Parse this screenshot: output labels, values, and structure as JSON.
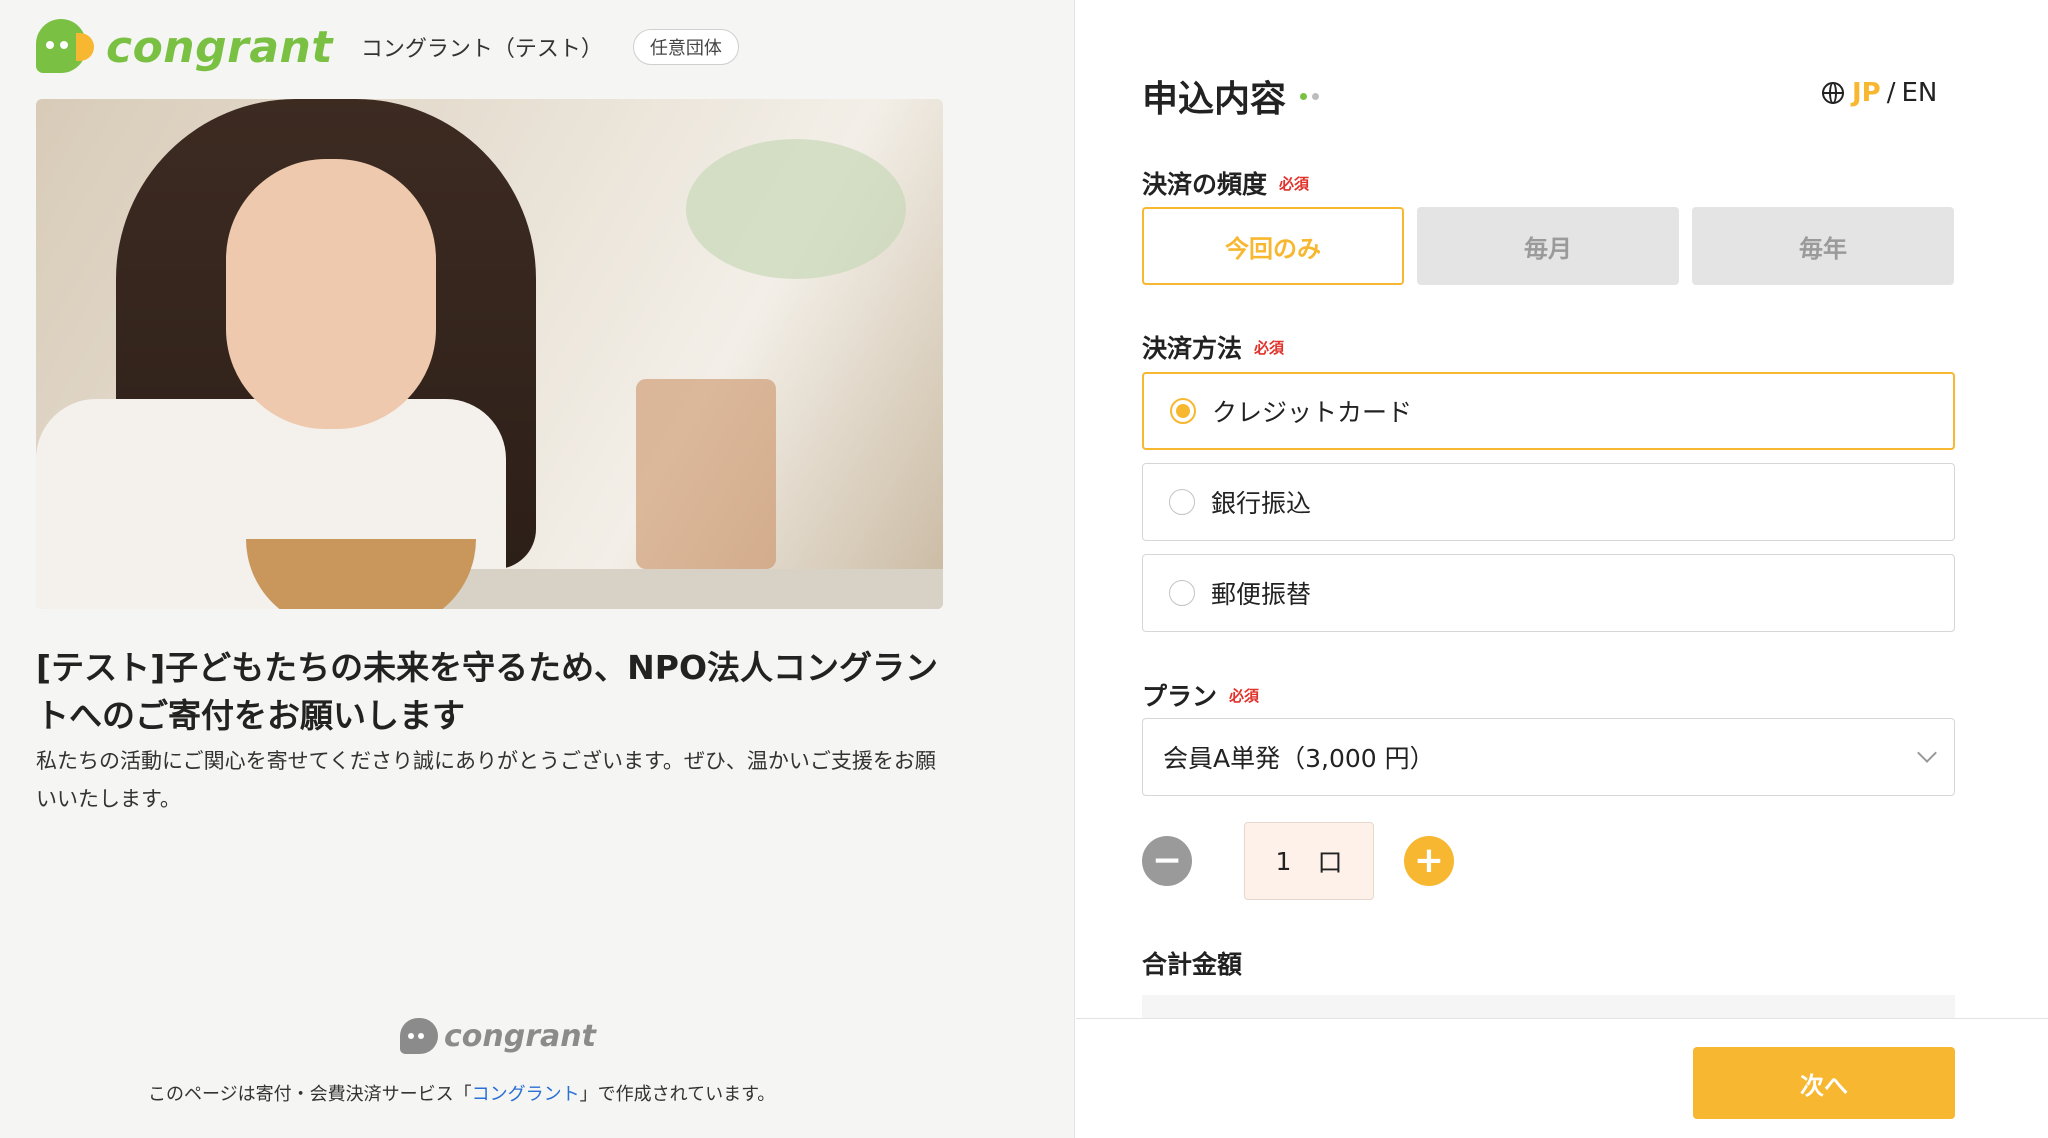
{
  "brand": {
    "logo_text": "congrant",
    "org_name": "コングラント（テスト）",
    "org_badge": "任意団体",
    "green": "#7ac143",
    "yellow": "#f7b731"
  },
  "campaign": {
    "title": "[テスト]子どもたちの未来を守るため、NPO法人コングラントへのご寄付をお願いします",
    "description": "私たちの活動にご関心を寄せてくださり誠にありがとうございます。ぜひ、温かいご支援をお願いいたします。"
  },
  "footer": {
    "logo_text": "congrant",
    "note_prefix": "このページは寄付・会費決済サービス「",
    "note_link": "コングラント",
    "note_suffix": "」で作成されています。"
  },
  "form": {
    "section_title": "申込内容",
    "lang": {
      "jp": "JP",
      "sep": "/",
      "en": "EN"
    },
    "required_label": "必須",
    "frequency": {
      "label": "決済の頻度",
      "options": [
        {
          "label": "今回のみ",
          "active": true
        },
        {
          "label": "毎月",
          "active": false
        },
        {
          "label": "毎年",
          "active": false
        }
      ]
    },
    "payment_method": {
      "label": "決済方法",
      "options": [
        {
          "label": "クレジットカード",
          "selected": true
        },
        {
          "label": "銀行振込",
          "selected": false
        },
        {
          "label": "郵便振替",
          "selected": false
        }
      ]
    },
    "plan": {
      "label": "プラン",
      "selected": "会員A単発（3,000 円）"
    },
    "quantity": {
      "value": "1",
      "unit": "口",
      "minus": "−",
      "plus": "+"
    },
    "total_label": "合計金額",
    "next_label": "次へ"
  }
}
